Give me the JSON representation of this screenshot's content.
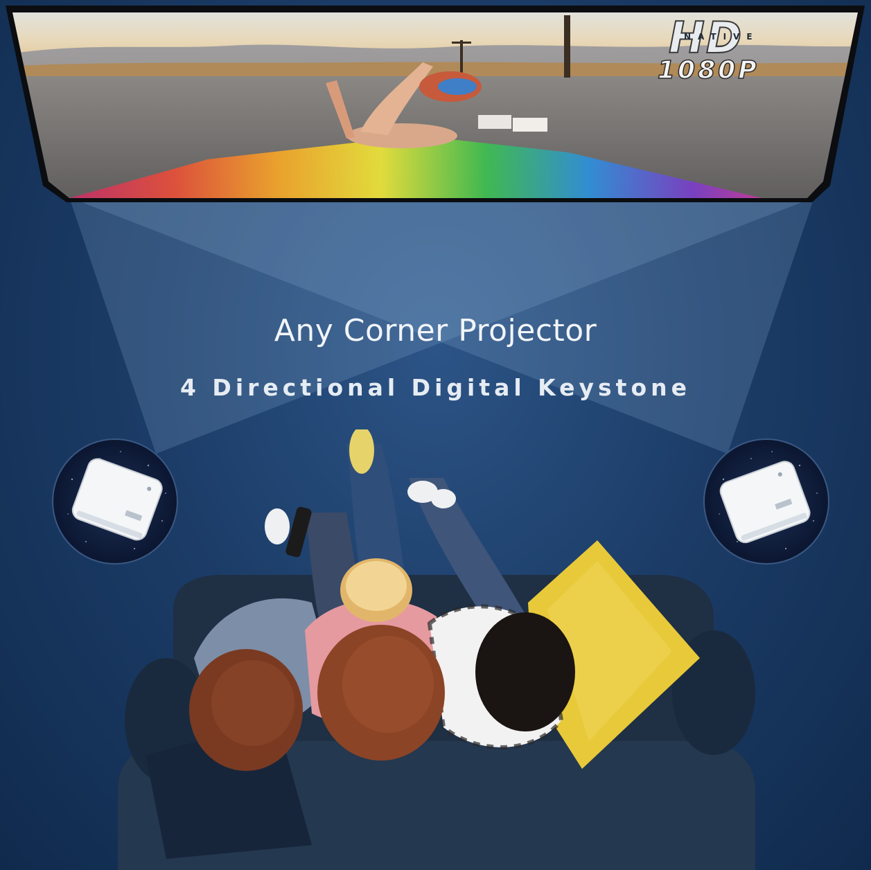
{
  "badge": {
    "mark": "HD",
    "overlay": "NATIVE",
    "resolution": "1080P"
  },
  "headline": "Any Corner Projector",
  "subheadline": "4 Directional Digital Keystone",
  "scene": {
    "screen_image": "road-sunset-rainbow-scene",
    "left_device": "projector-icon",
    "right_device": "projector-icon",
    "foreground": "family-on-sofa-with-popcorn"
  },
  "colors": {
    "background": "#1c3d68",
    "beam": "#7d9cc2",
    "text": "#f2f5f9",
    "pillow": "#e7c93a",
    "sofa": "#1f2f44"
  }
}
